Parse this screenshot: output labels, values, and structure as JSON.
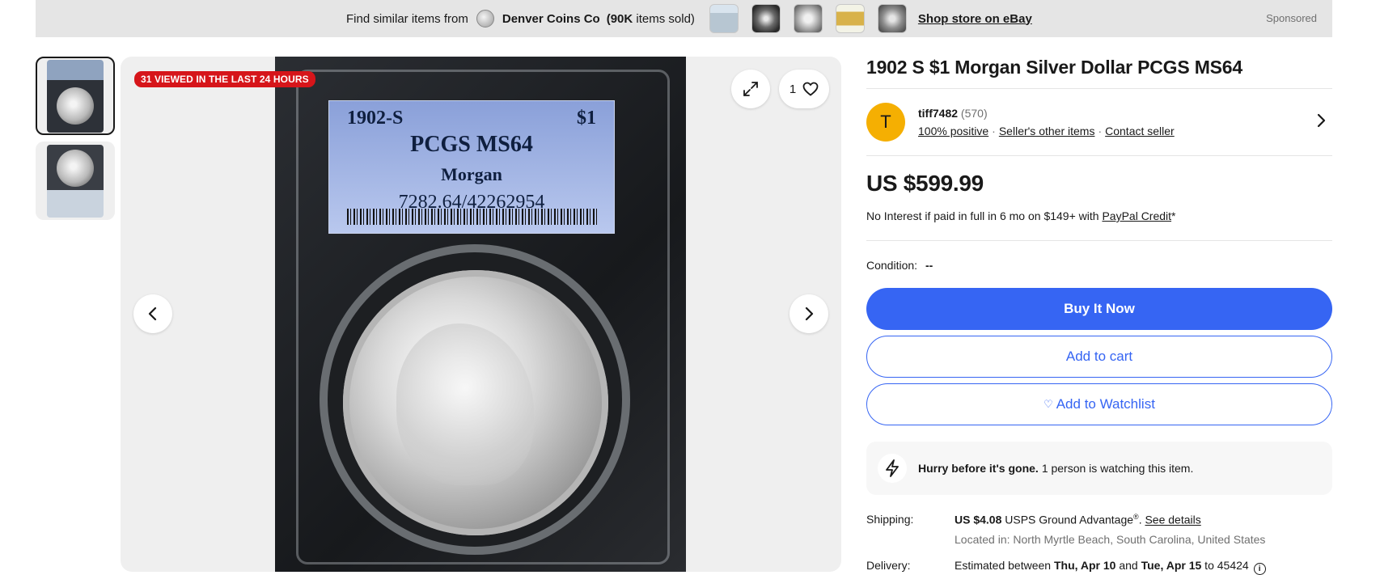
{
  "banner": {
    "find_text": "Find similar items from",
    "store_name": "Denver Coins Co",
    "items_sold_bold": "(90K",
    "items_sold_rest": " items sold)",
    "shop_link": "Shop store on eBay",
    "sponsored": "Sponsored"
  },
  "gallery": {
    "badge": "31 VIEWED IN THE LAST 24 HOURS",
    "watch_count": "1",
    "slab_label": {
      "year": "1902-S",
      "denomination": "$1",
      "grade": "PCGS MS64",
      "type": "Morgan",
      "cert": "7282.64/42262954"
    }
  },
  "item": {
    "title": "1902 S $1 Morgan Silver Dollar PCGS MS64",
    "price": "US $599.99",
    "financing_prefix": "No Interest if paid in full in 6 mo on $149+ with ",
    "financing_link": "PayPal Credit",
    "financing_suffix": "*",
    "condition_label": "Condition:",
    "condition_value": "--"
  },
  "seller": {
    "avatar_letter": "T",
    "name": "tiff7482",
    "feedback_count": "(570)",
    "positive": "100% positive",
    "other_items": "Seller's other items",
    "contact": "Contact seller"
  },
  "actions": {
    "buy_now": "Buy It Now",
    "add_to_cart": "Add to cart",
    "add_to_watchlist": "Add to Watchlist"
  },
  "urgency": {
    "bold": "Hurry before it's gone.",
    "text": "1 person is watching this item."
  },
  "shipping": {
    "label": "Shipping:",
    "cost": "US $4.08",
    "service": " USPS Ground Advantage",
    "reg": "®",
    "period": ".",
    "details_link": "See details",
    "located": "Located in: North Myrtle Beach, South Carolina, United States"
  },
  "delivery": {
    "label": "Delivery:",
    "prefix": "Estimated between ",
    "start": "Thu, Apr 10",
    "and": " and ",
    "end": "Tue, Apr 15",
    "suffix": " to 45424"
  },
  "colors": {
    "primary_blue": "#3665f3",
    "badge_red": "#d6151a",
    "avatar_yellow": "#f5af02"
  },
  "icons": [
    "store-logo-icon",
    "expand-icon",
    "heart-icon",
    "chevron-left-icon",
    "chevron-right-icon",
    "bolt-icon",
    "info-icon"
  ]
}
